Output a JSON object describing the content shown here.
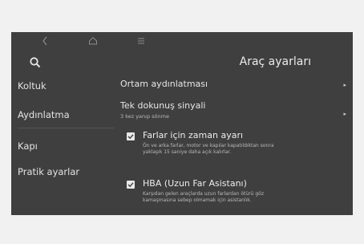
{
  "header": {
    "title": "Araç ayarları",
    "icons": [
      "back-icon",
      "home-icon",
      "menu-icon",
      "search-icon"
    ]
  },
  "sidebar": {
    "items": [
      {
        "label": "Koltuk"
      },
      {
        "label": "Aydınlatma"
      },
      {
        "label": "Kapı"
      },
      {
        "label": "Pratik ayarlar"
      }
    ]
  },
  "main": {
    "rows": [
      {
        "label": "Ortam aydınlatması"
      },
      {
        "label": "Tek dokunuş sinyali",
        "sub": "3 kez yanıp sönme"
      }
    ],
    "checks": [
      {
        "label": "Farlar için zaman ayarı",
        "desc1": "Ön ve arka farlar, motor ve kapılar kapatıldıktan sonra",
        "desc2": "yaklaşık 15 saniye daha açık kalırlar.",
        "checked": true
      },
      {
        "label": "HBA (Uzun Far Asistanı)",
        "desc1": "Karşıdan gelen araçlarda uzun farlardan ötürü göz",
        "desc2": "kamaşmasına sebep olmamak için asistanlık.",
        "checked": true
      }
    ]
  },
  "colors": {
    "screen": "#3f3f3f",
    "text": "#e6e6e6",
    "muted": "#b8b8b8"
  }
}
